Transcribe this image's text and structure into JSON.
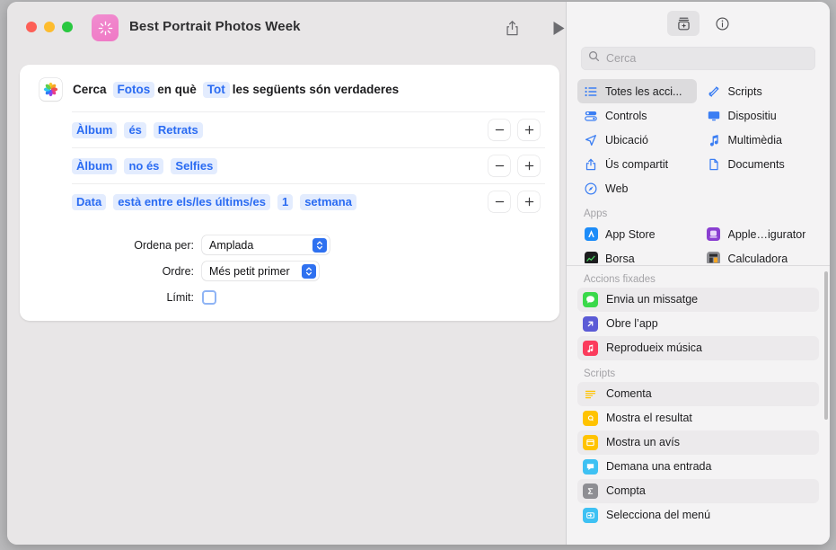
{
  "window": {
    "title": "Best Portrait Photos Week",
    "app_icon": "shortcuts-icon",
    "traffic_lights": [
      "close",
      "minimize",
      "zoom"
    ],
    "toolbar": {
      "share_label": "share-icon",
      "run_label": "run-icon"
    }
  },
  "editor": {
    "action": {
      "app_icon": "photos-icon",
      "prefix": "Cerca",
      "source_token": "Fotos",
      "middle": "en què",
      "match_token": "Tot",
      "suffix": "les següents són verdaderes"
    },
    "filters": [
      {
        "tokens": [
          "Àlbum",
          "és",
          "Retrats"
        ]
      },
      {
        "tokens": [
          "Àlbum",
          "no és",
          "Selfies"
        ]
      },
      {
        "tokens": [
          "Data",
          "està entre els/les últims/es",
          "1",
          "setmana"
        ]
      }
    ],
    "row_buttons": {
      "remove": "−",
      "add": "+"
    },
    "options": [
      {
        "label": "Ordena per:",
        "value": "Amplada",
        "control": "popup"
      },
      {
        "label": "Ordre:",
        "value": "Més petit primer",
        "control": "popup"
      }
    ],
    "limit": {
      "label": "Límit:",
      "checked": false
    }
  },
  "sidebar": {
    "toolbar": [
      {
        "name": "action-library-button",
        "icon": "library-add-icon",
        "selected": true
      },
      {
        "name": "info-button",
        "icon": "info-circle-icon",
        "selected": false
      }
    ],
    "search": {
      "placeholder": "Cerca",
      "value": "",
      "icon": "search-icon"
    },
    "categories": [
      {
        "label": "Totes les acci...",
        "icon": "list-icon",
        "selected": true
      },
      {
        "label": "Scripts",
        "icon": "scripts-icon",
        "selected": false
      },
      {
        "label": "Controls",
        "icon": "controls-icon",
        "selected": false
      },
      {
        "label": "Dispositiu",
        "icon": "display-icon",
        "selected": false
      },
      {
        "label": "Ubicació",
        "icon": "location-arrow-icon",
        "selected": false
      },
      {
        "label": "Multimèdia",
        "icon": "music-note-icon",
        "selected": false
      },
      {
        "label": "Ús compartit",
        "icon": "share-icon",
        "selected": false
      },
      {
        "label": "Documents",
        "icon": "document-icon",
        "selected": false
      },
      {
        "label": "Web",
        "icon": "safari-compass-icon",
        "selected": false
      }
    ],
    "apps_section": {
      "header": "Apps",
      "items": [
        {
          "label": "App Store",
          "icon": "app-store-icon",
          "color": "#1d8cf8"
        },
        {
          "label": "Apple…igurator",
          "icon": "apple-configurator-icon",
          "color": "#8a3fd1"
        },
        {
          "label": "Borsa",
          "icon": "stocks-icon",
          "color": "#1c1c1e"
        },
        {
          "label": "Calculadora",
          "icon": "calculator-icon",
          "color": "#8e8e93"
        }
      ]
    },
    "pinned_section": {
      "header": "Accions fixades",
      "items": [
        {
          "label": "Envia un missatge",
          "icon": "messages-icon",
          "color": "#3ad94a",
          "highlighted": true
        },
        {
          "label": "Obre l’app",
          "icon": "open-app-icon",
          "color": "#5b5bd6",
          "highlighted": false
        },
        {
          "label": "Reprodueix música",
          "icon": "music-icon",
          "color": "#fb3b5c",
          "highlighted": true
        }
      ]
    },
    "scripts_section": {
      "header": "Scripts",
      "items": [
        {
          "label": "Comenta",
          "icon": "comment-icon",
          "color": "#ffffff",
          "highlighted": true
        },
        {
          "label": "Mostra el resultat",
          "icon": "show-result-icon",
          "color": "#ffc300",
          "highlighted": false
        },
        {
          "label": "Mostra un avís",
          "icon": "show-alert-icon",
          "color": "#ffc300",
          "highlighted": true
        },
        {
          "label": "Demana una entrada",
          "icon": "ask-input-icon",
          "color": "#3ec1f3",
          "highlighted": false
        },
        {
          "label": "Compta",
          "icon": "count-sigma-icon",
          "color": "#8e8e93",
          "highlighted": true
        },
        {
          "label": "Selecciona del menú",
          "icon": "choose-menu-icon",
          "color": "#3ec1f3",
          "highlighted": false
        }
      ]
    }
  },
  "colors": {
    "token_bg": "#e3ecfe",
    "token_text": "#2a6bf2",
    "accent": "#2f71f0",
    "window_bg": "#e8e6e7",
    "sidebar_bg": "#f4f3f4"
  }
}
